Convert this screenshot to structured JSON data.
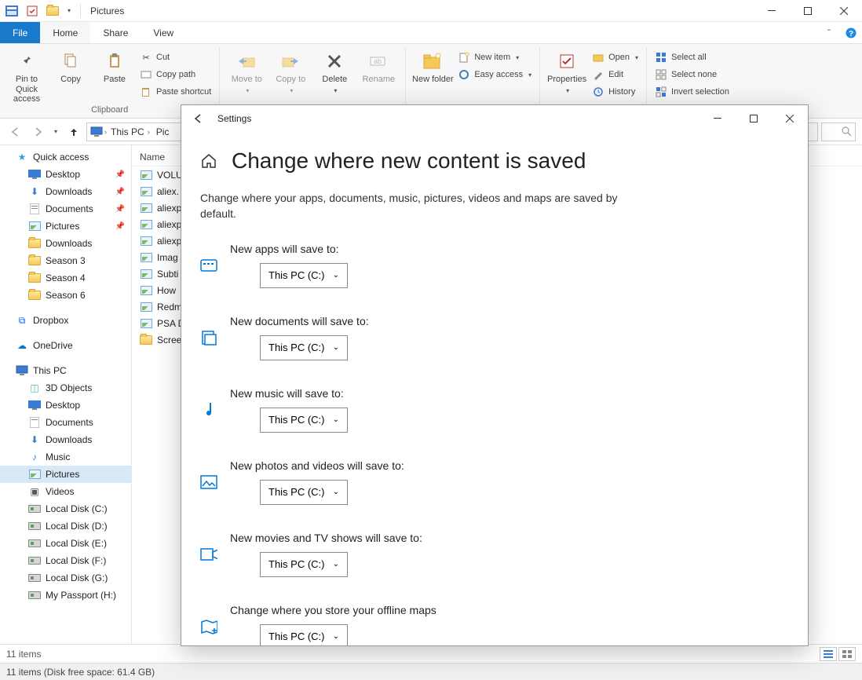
{
  "window": {
    "title": "Pictures"
  },
  "menubar": {
    "file": "File",
    "home": "Home",
    "share": "Share",
    "view": "View"
  },
  "ribbon": {
    "pin": "Pin to Quick access",
    "copy": "Copy",
    "paste": "Paste",
    "cut": "Cut",
    "copypath": "Copy path",
    "pasteshortcut": "Paste shortcut",
    "clipboard_label": "Clipboard",
    "moveto": "Move to",
    "copyto": "Copy to",
    "delete": "Delete",
    "rename": "Rename",
    "newfolder": "New folder",
    "newitem": "New item",
    "easyaccess": "Easy access",
    "properties": "Properties",
    "open": "Open",
    "edit": "Edit",
    "history": "History",
    "selectall": "Select all",
    "selectnone": "Select none",
    "invert": "Invert selection"
  },
  "breadcrumb": {
    "seg1": "This PC",
    "seg2": "Pic"
  },
  "sidebar": {
    "quick": "Quick access",
    "q_desktop": "Desktop",
    "q_downloads": "Downloads",
    "q_documents": "Documents",
    "q_pictures": "Pictures",
    "q_downloads2": "Downloads",
    "q_s3": "Season 3",
    "q_s4": "Season 4",
    "q_s6": "Season 6",
    "dropbox": "Dropbox",
    "onedrive": "OneDrive",
    "thispc": "This PC",
    "pc_3d": "3D Objects",
    "pc_desktop": "Desktop",
    "pc_documents": "Documents",
    "pc_downloads": "Downloads",
    "pc_music": "Music",
    "pc_pictures": "Pictures",
    "pc_videos": "Videos",
    "pc_c": "Local Disk (C:)",
    "pc_d": "Local Disk (D:)",
    "pc_e": "Local Disk (E:)",
    "pc_f": "Local Disk (F:)",
    "pc_g": "Local Disk (G:)",
    "pc_passport": "My Passport (H:)"
  },
  "filelist": {
    "col_name": "Name",
    "items": [
      "VOLU",
      "aliex.",
      "aliexp",
      "aliexp",
      "aliexp",
      "Imag",
      "Subti",
      "How",
      "Redm",
      "PSA D",
      "Scree"
    ]
  },
  "status": {
    "count": "11 items",
    "free": "11 items (Disk free space: 61.4 GB)"
  },
  "settings": {
    "app": "Settings",
    "heading": "Change where new content is saved",
    "desc": "Change where your apps, documents, music, pictures, videos and maps are saved by default.",
    "rows": {
      "apps": "New apps will save to:",
      "docs": "New documents will save to:",
      "music": "New music will save to:",
      "photos": "New photos and videos will save to:",
      "movies": "New movies and TV shows will save to:",
      "maps": "Change where you store your offline maps"
    },
    "value": "This PC (C:)"
  }
}
